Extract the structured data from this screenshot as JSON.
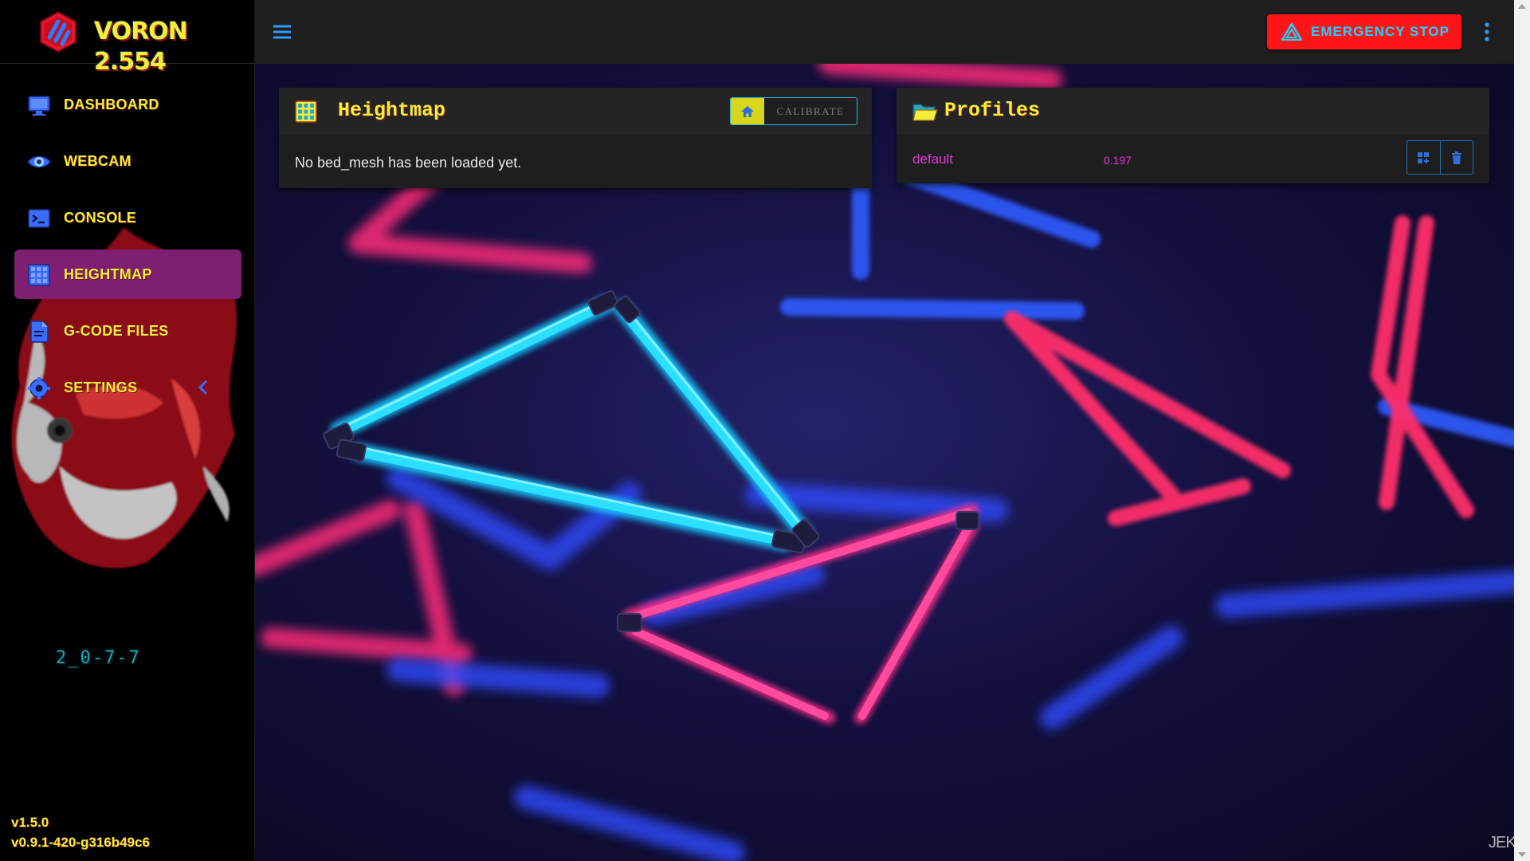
{
  "brand": {
    "title": "VORON 2.554"
  },
  "sidebar": {
    "items": [
      {
        "label": "DASHBOARD",
        "icon": "monitor-dashboard-icon",
        "active": false
      },
      {
        "label": "WEBCAM",
        "icon": "eye-webcam-icon",
        "active": false
      },
      {
        "label": "CONSOLE",
        "icon": "console-icon",
        "active": false
      },
      {
        "label": "HEIGHTMAP",
        "icon": "grid-heightmap-icon",
        "active": true
      },
      {
        "label": "G-CODE FILES",
        "icon": "file-gcode-icon",
        "active": false
      },
      {
        "label": "SETTINGS",
        "icon": "settings-gear-icon",
        "active": false
      }
    ],
    "motto": "2_0-7-7",
    "version_client": "v1.5.0",
    "version_server": "v0.9.1-420-g316b49c6"
  },
  "topbar": {
    "emergency_stop_label": "EMERGENCY STOP"
  },
  "heightmap": {
    "title": "Heightmap",
    "calibrate_label": "CALIBRATE",
    "empty_message": "No bed_mesh has been loaded yet."
  },
  "profiles": {
    "title": "Profiles",
    "rows": [
      {
        "name": "default",
        "value": "0.197"
      }
    ]
  },
  "watermark": "JEK",
  "colors": {
    "accent_yellow": "#f2ee3a",
    "active_item": "#7e1f72",
    "estop_red": "#ff1515",
    "cyan": "#1fd1ff",
    "magenta": "#e536d9",
    "card_bg": "#1e1e1e"
  }
}
